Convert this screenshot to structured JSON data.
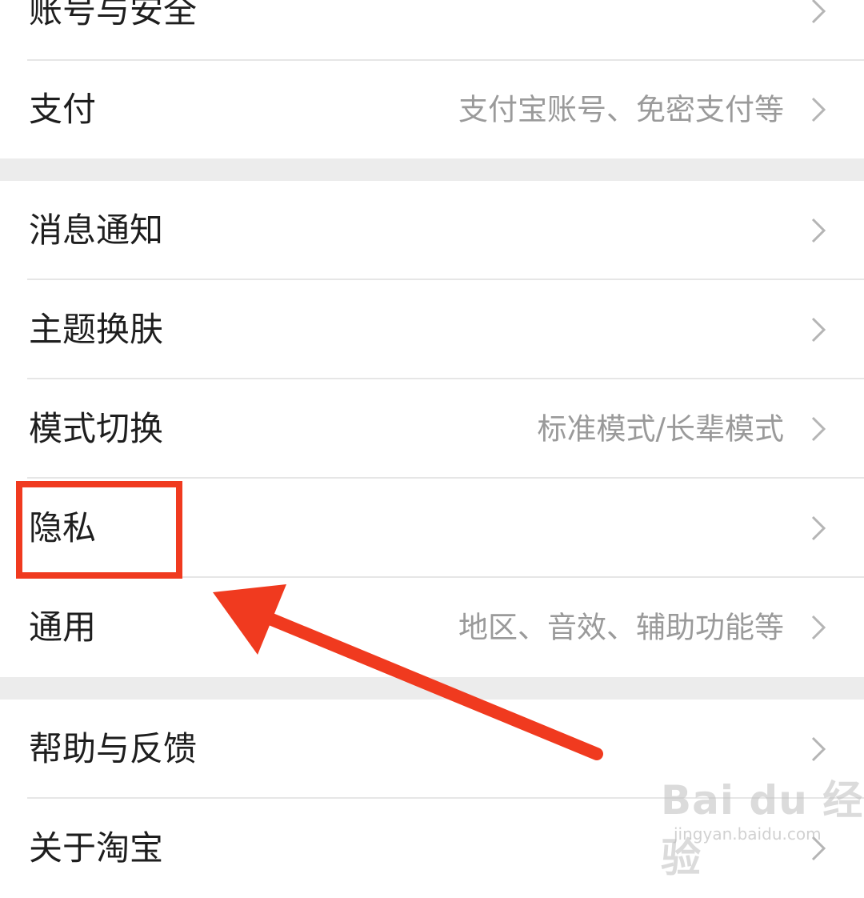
{
  "settings": {
    "group1": [
      {
        "label": "账号与安全",
        "value": ""
      },
      {
        "label": "支付",
        "value": "支付宝账号、免密支付等"
      }
    ],
    "group2": [
      {
        "label": "消息通知",
        "value": ""
      },
      {
        "label": "主题换肤",
        "value": ""
      },
      {
        "label": "模式切换",
        "value": "标准模式/长辈模式"
      },
      {
        "label": "隐私",
        "value": ""
      },
      {
        "label": "通用",
        "value": "地区、音效、辅助功能等"
      }
    ],
    "group3": [
      {
        "label": "帮助与反馈",
        "value": ""
      },
      {
        "label": "关于淘宝",
        "value": ""
      }
    ]
  },
  "annotation": {
    "highlight_color": "#f03a1f",
    "target_item": "隐私"
  },
  "watermark": {
    "logo": "Bai du 经验",
    "url": "jingyan.baidu.com"
  },
  "icons": {
    "chevron": "chevron-right-icon"
  }
}
